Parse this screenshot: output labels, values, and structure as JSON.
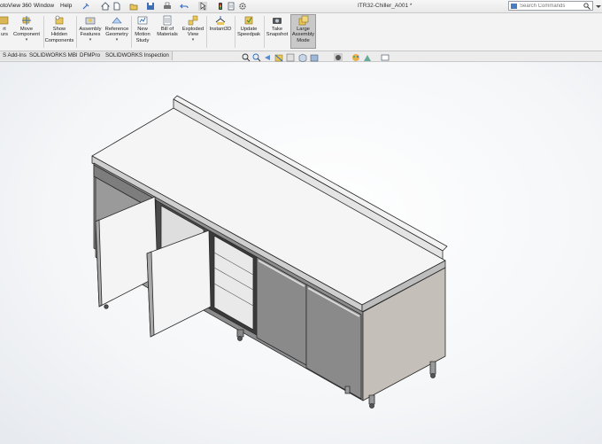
{
  "menubar": {
    "items": [
      "otoView 360",
      "Window",
      "Help"
    ],
    "document_title": "ITR32-Chiller_A001 *"
  },
  "search": {
    "placeholder": "Search Commands"
  },
  "command_manager": {
    "tools": [
      {
        "label": "rt\nurs"
      },
      {
        "label": "Move\nComponent"
      },
      {
        "label": "Show\nHidden\nComponents"
      },
      {
        "label": "Assembly\nFeatures"
      },
      {
        "label": "Reference\nGeometry"
      },
      {
        "label": "New\nMotion\nStudy"
      },
      {
        "label": "Bill of\nMaterials"
      },
      {
        "label": "Exploded\nView"
      },
      {
        "label": "Instant3D"
      },
      {
        "label": "Update\nSpeedpak"
      },
      {
        "label": "Take\nSnapshot"
      },
      {
        "label": "Large\nAssembly\nMode"
      }
    ]
  },
  "tabs": [
    "S Add-Ins",
    "SOLIDWORKS MBD",
    "DFMPro",
    "SOLIDWORKS Inspection"
  ],
  "colors": {
    "accent_active": "#c9c9c9",
    "model_top": "#f4f4f4",
    "model_steel": "#8c8c8c",
    "model_side": "#c4bfb8"
  }
}
